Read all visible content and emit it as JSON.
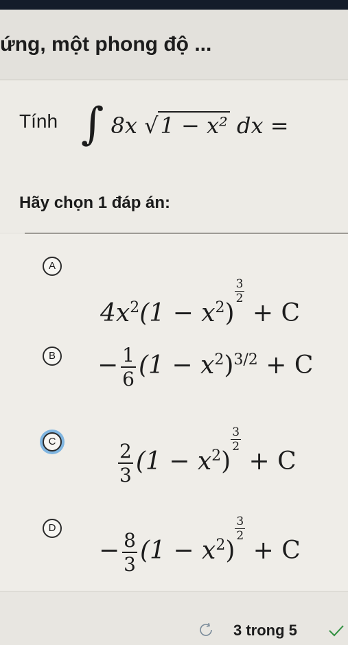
{
  "header": {
    "title": "ứng, một phong độ ..."
  },
  "question": {
    "prefix": "Tính",
    "integrand": "8x",
    "radicand": "1 − x²",
    "tail": "dx ="
  },
  "instruction": "Hãy chọn 1 đáp án:",
  "options": [
    {
      "letter": "A",
      "selected": false
    },
    {
      "letter": "B",
      "selected": false
    },
    {
      "letter": "C",
      "selected": true
    },
    {
      "letter": "D",
      "selected": false
    }
  ],
  "option_formulas": {
    "A": {
      "coef": "4x",
      "coef_exp": "2",
      "base": "(1 − x",
      "base_exp": "2",
      "close": ")",
      "exp_num": "3",
      "exp_den": "2",
      "tail": "+ C"
    },
    "B": {
      "sign": "−",
      "num": "1",
      "den": "6",
      "base": "(1 − x",
      "base_exp": "2",
      "close": ")",
      "exp": "3/2",
      "tail": "+ C"
    },
    "C": {
      "num": "2",
      "den": "3",
      "base": "(1 − x",
      "base_exp": "2",
      "close": ")",
      "exp_num": "3",
      "exp_den": "2",
      "tail": "+ C"
    },
    "D": {
      "sign": "−",
      "num": "8",
      "den": "3",
      "base": "(1 − x",
      "base_exp": "2",
      "close": ")",
      "exp_num": "3",
      "exp_den": "2",
      "tail": "+ C"
    }
  },
  "footer": {
    "progress": "3 trong 5"
  },
  "colors": {
    "selected_ring": "#7fb5e0",
    "topbar": "#141c2a"
  }
}
